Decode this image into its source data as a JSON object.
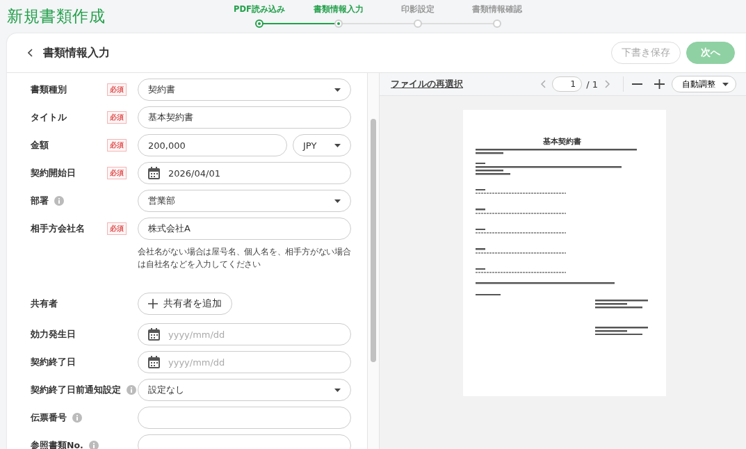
{
  "page_title": "新規書類作成",
  "steps": [
    {
      "label": "PDF読み込み",
      "completed": true,
      "selected": false
    },
    {
      "label": "書類情報入力",
      "completed": false,
      "selected": true
    },
    {
      "label": "印影設定",
      "completed": false,
      "selected": false
    },
    {
      "label": "書類情報確認",
      "completed": false,
      "selected": false
    }
  ],
  "card": {
    "title": "書類情報入力",
    "buttons": [
      {
        "label": "下書き保存",
        "kind": "outline",
        "disabled": true
      },
      {
        "label": "次へ",
        "kind": "primary",
        "disabled": true
      }
    ]
  },
  "form": {
    "fields": [
      {
        "label": "書類種別",
        "required_badge": "必須",
        "info": false,
        "kind": "select",
        "value": "契約書"
      },
      {
        "label": "タイトル",
        "required_badge": "必須",
        "info": false,
        "kind": "text",
        "value": "基本契約書"
      },
      {
        "label": "金額",
        "required_badge": "必須",
        "info": false,
        "kind": "amount",
        "value": "200,000",
        "currency": "JPY"
      },
      {
        "label": "契約開始日",
        "required_badge": "必須",
        "info": false,
        "kind": "date",
        "value": "2026/04/01"
      },
      {
        "label": "部署",
        "info": true,
        "kind": "select",
        "value": "営業部"
      },
      {
        "label": "相手方会社名",
        "required_badge": "必須",
        "info": false,
        "kind": "text",
        "value": "株式会社A",
        "helper": "会社名がない場合は屋号名、個人名を、相手方がない場合は自社名などを入力してください"
      },
      {
        "label": "共有者",
        "info": false,
        "kind": "add",
        "button": "共有者を追加"
      },
      {
        "label": "効力発生日",
        "info": false,
        "kind": "date",
        "placeholder": "yyyy/mm/dd"
      },
      {
        "label": "契約終了日",
        "info": false,
        "kind": "date",
        "placeholder": "yyyy/mm/dd"
      },
      {
        "label": "契約終了日前通知設定",
        "info": true,
        "kind": "select",
        "value": "設定なし"
      },
      {
        "label": "伝票番号",
        "info": true,
        "kind": "text"
      },
      {
        "label": "参照書類No.",
        "info": true,
        "kind": "text"
      }
    ]
  },
  "preview": {
    "reselect_link": "ファイルの再選択",
    "page_input": "1",
    "page_total": "/ 1",
    "zoom_select": "自動調整",
    "document": {
      "title": "基本契約書"
    }
  }
}
